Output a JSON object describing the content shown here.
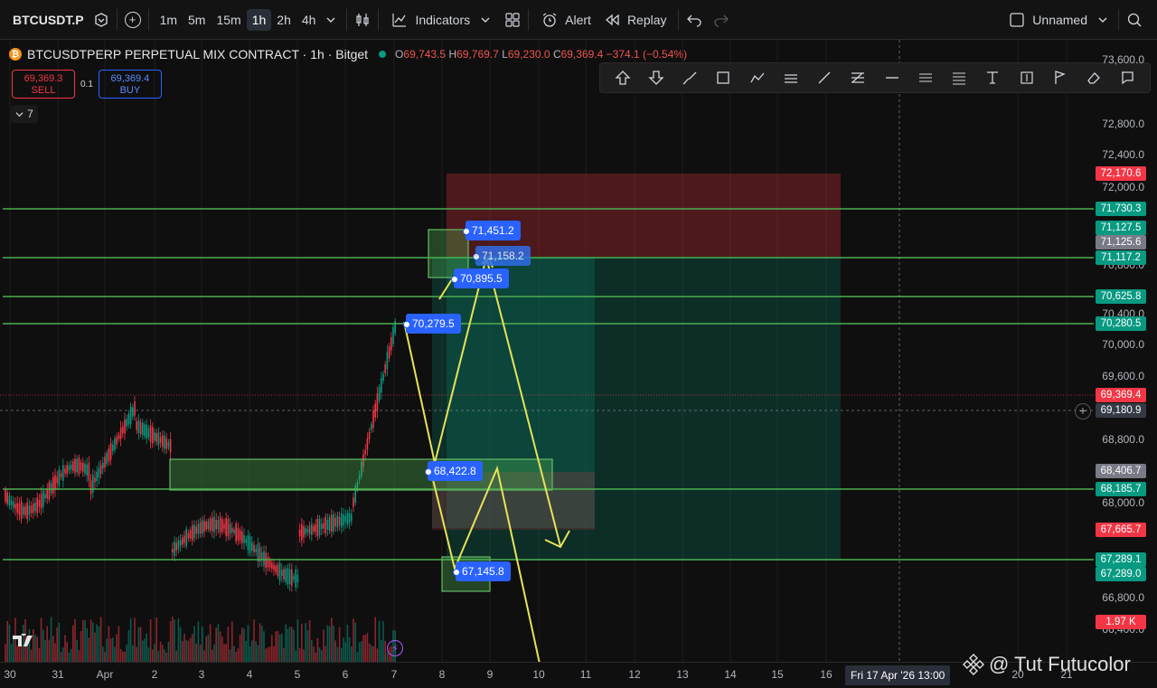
{
  "toolbar": {
    "symbol": "BTCUSDT.P",
    "intervals": [
      "1m",
      "5m",
      "15m",
      "1h",
      "2h",
      "4h"
    ],
    "active_interval": "1h",
    "indicators_label": "Indicators",
    "alert_label": "Alert",
    "replay_label": "Replay",
    "layout_name": "Unnamed"
  },
  "legend": {
    "title": "BTCUSDTPERP PERPETUAL MIX CONTRACT · 1h · Bitget",
    "open_label": "O",
    "open": "69,743.5",
    "high_label": "H",
    "high": "69,769.7",
    "low_label": "L",
    "low": "69,230.0",
    "close_label": "C",
    "close": "69,369.4",
    "change": "−374.1 (−0.54%)"
  },
  "trade": {
    "sell_price": "69,369.3",
    "sell_label": "SELL",
    "spread": "0.1",
    "buy_price": "69,369.4",
    "buy_label": "BUY"
  },
  "collapse_count": "7",
  "price_axis": {
    "ticks": [
      "73,600.0",
      "72,800.0",
      "72,400.0",
      "72,000.0",
      "70,800.0",
      "70,400.0",
      "70,000.0",
      "69,600.0",
      "68,800.0",
      "68,000.0",
      "66,800.0",
      "66,400.0"
    ],
    "labels": [
      {
        "text": "72,170.6",
        "color": "#f23645"
      },
      {
        "text": "71,730.3",
        "color": "#089981"
      },
      {
        "text": "71,127.5",
        "color": "#089981"
      },
      {
        "text": "71,125.6",
        "color": "#787b86"
      },
      {
        "text": "71,117.2",
        "color": "#089981"
      },
      {
        "text": "70,625.8",
        "color": "#089981"
      },
      {
        "text": "70,280.5",
        "color": "#089981"
      },
      {
        "text": "69,369.4",
        "color": "#f23645"
      },
      {
        "text": "69,180.9",
        "color": "#363a45"
      },
      {
        "text": "68,406.7",
        "color": "#787b86"
      },
      {
        "text": "68,185.7",
        "color": "#089981"
      },
      {
        "text": "67,665.7",
        "color": "#f23645"
      },
      {
        "text": "67,289.1",
        "color": "#089981"
      },
      {
        "text": "67,289.0",
        "color": "#089981"
      },
      {
        "text": "1.97 K",
        "color": "#f23645"
      }
    ]
  },
  "time_axis": {
    "ticks": [
      "30",
      "31",
      "Apr",
      "2",
      "3",
      "4",
      "5",
      "6",
      "7",
      "8",
      "9",
      "10",
      "11",
      "12",
      "13",
      "14",
      "15",
      "16",
      "20",
      "21"
    ],
    "cursor": "Fri 17 Apr '26   13:00"
  },
  "chart_labels": [
    "71,451.2",
    "71,158.2",
    "70,895.5",
    "70,279.5",
    "68,422.8",
    "67,145.8"
  ],
  "watermark": "@ Tut Futucolor",
  "tv_logo": "17"
}
